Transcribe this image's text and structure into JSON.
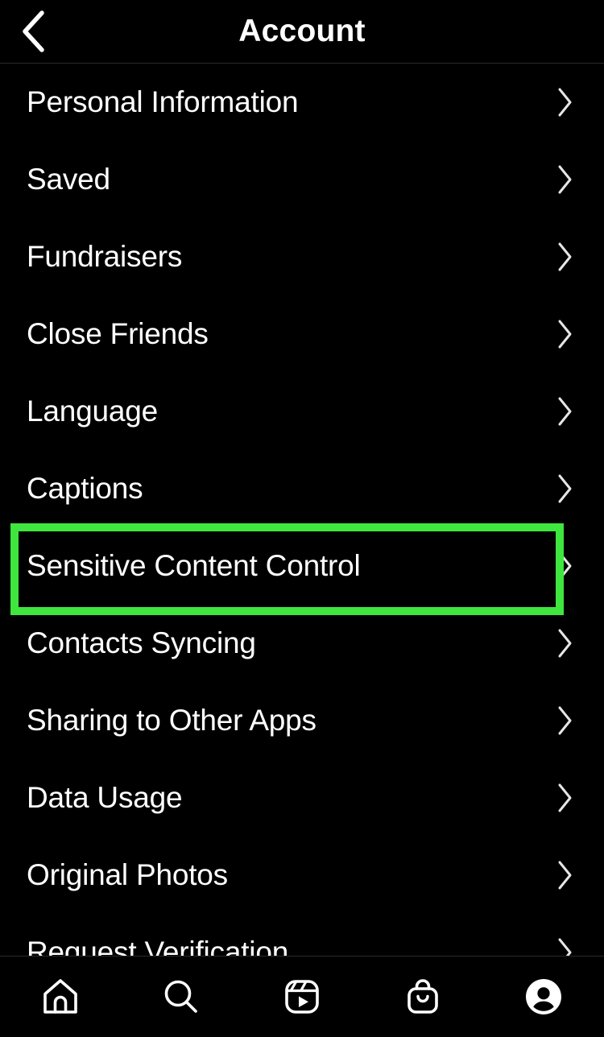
{
  "header": {
    "title": "Account",
    "back_icon": "chevron-left-icon"
  },
  "accent_color": "#3ee63e",
  "background_color": "#000000",
  "text_color": "#ffffff",
  "list": {
    "row_chevron_icon": "chevron-right-icon",
    "items": [
      {
        "label": "Personal Information",
        "highlighted": false
      },
      {
        "label": "Saved",
        "highlighted": false
      },
      {
        "label": "Fundraisers",
        "highlighted": false
      },
      {
        "label": "Close Friends",
        "highlighted": false
      },
      {
        "label": "Language",
        "highlighted": false
      },
      {
        "label": "Captions",
        "highlighted": false
      },
      {
        "label": "Sensitive Content Control",
        "highlighted": true
      },
      {
        "label": "Contacts Syncing",
        "highlighted": false
      },
      {
        "label": "Sharing to Other Apps",
        "highlighted": false
      },
      {
        "label": "Data Usage",
        "highlighted": false
      },
      {
        "label": "Original Photos",
        "highlighted": false
      },
      {
        "label": "Request Verification",
        "highlighted": false
      }
    ]
  },
  "tabbar": {
    "items": [
      {
        "name": "home",
        "icon": "home-icon",
        "active": false
      },
      {
        "name": "search",
        "icon": "search-icon",
        "active": false
      },
      {
        "name": "reels",
        "icon": "reels-icon",
        "active": false
      },
      {
        "name": "shop",
        "icon": "shop-bag-icon",
        "active": false
      },
      {
        "name": "profile",
        "icon": "profile-avatar-icon",
        "active": true
      }
    ]
  }
}
